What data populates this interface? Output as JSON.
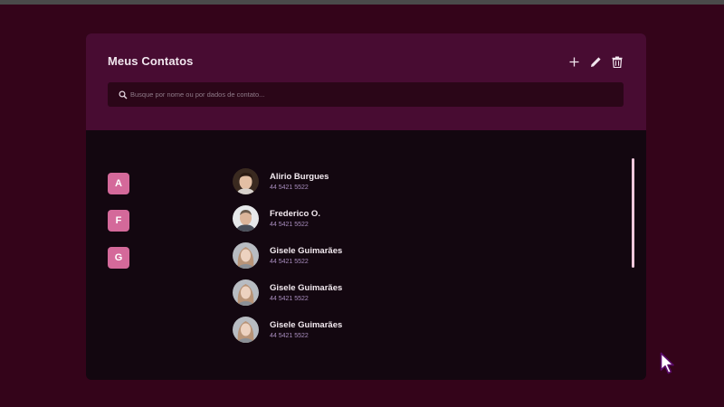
{
  "header": {
    "title": "Meus Contatos",
    "actions": [
      {
        "name": "add",
        "icon": "plus-icon"
      },
      {
        "name": "edit",
        "icon": "pencil-icon"
      },
      {
        "name": "delete",
        "icon": "trash-icon"
      }
    ]
  },
  "search": {
    "placeholder": "Busque por nome ou por dados de contato...",
    "value": ""
  },
  "letters": [
    "A",
    "F",
    "G"
  ],
  "contacts": [
    {
      "name": "Alirio Burgues",
      "phone": "44 5421 5522"
    },
    {
      "name": "Frederico O.",
      "phone": "44 5421 5522"
    },
    {
      "name": "Gisele Guimarães",
      "phone": "44 5421 5522"
    },
    {
      "name": "Gisele Guimarães",
      "phone": "44 5421 5522"
    },
    {
      "name": "Gisele Guimarães",
      "phone": "44 5421 5522"
    }
  ],
  "colors": {
    "background": "#34041a",
    "header": "#480c32",
    "panel": "#130710",
    "accent": "#d4699a",
    "phone": "#a98ebf"
  }
}
